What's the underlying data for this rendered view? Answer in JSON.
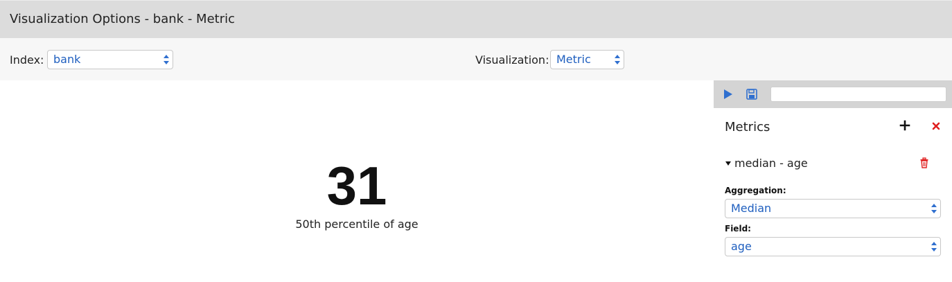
{
  "window": {
    "title": "Visualization Options - bank - Metric"
  },
  "toolbar": {
    "index_label": "Index:",
    "index_value": "bank",
    "visualization_label": "Visualization:",
    "visualization_value": "Metric"
  },
  "metric_display": {
    "value": "31",
    "label": "50th percentile of age"
  },
  "side_panel": {
    "search_placeholder": "",
    "metrics_header": "Metrics",
    "metric_item": {
      "label": "median - age"
    },
    "aggregation_label": "Aggregation:",
    "aggregation_value": "Median",
    "field_label": "Field:",
    "field_value": "age"
  },
  "icons": {
    "run": "play-icon",
    "save": "floppy-disk-icon",
    "add": "plus-icon",
    "close": "close-icon",
    "expand": "caret-down-icon",
    "delete": "trash-icon",
    "select_arrows": "select-arrows-icon"
  },
  "colors": {
    "accent_blue": "#2f6fcf",
    "delete_red": "#e02020",
    "title_bar": "#dcdcdc"
  }
}
